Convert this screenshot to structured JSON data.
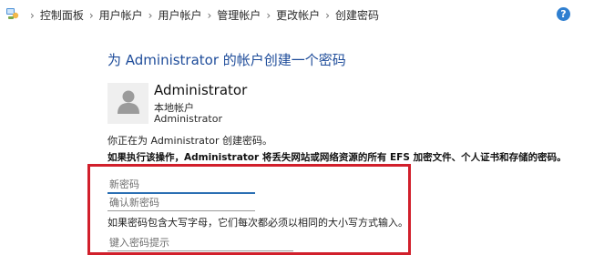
{
  "breadcrumb": {
    "items": [
      "控制面板",
      "用户帐户",
      "用户帐户",
      "管理帐户",
      "更改帐户",
      "创建密码"
    ],
    "separator": "›"
  },
  "help": {
    "label": "?"
  },
  "page": {
    "title": "为 Administrator 的帐户创建一个密码"
  },
  "account": {
    "name": "Administrator",
    "type": "本地帐户",
    "group": "Administrator"
  },
  "messages": {
    "info": "你正在为 Administrator 创建密码。",
    "warning": "如果执行该操作，Administrator 将丢失网站或网络资源的所有 EFS 加密文件、个人证书和存储的密码。",
    "case_note": "如果密码包含大写字母，它们每次都必须以相同的大小写方式输入。"
  },
  "form": {
    "new_password_placeholder": "新密码",
    "confirm_password_placeholder": "确认新密码",
    "hint_placeholder": "键入密码提示"
  },
  "colors": {
    "title": "#1e4c9a",
    "highlight_border": "#d11f2b",
    "help_icon": "#2f7fd0",
    "avatar_bg": "#efefef"
  },
  "icons": [
    "control-panel-icon",
    "help-icon",
    "user-avatar-icon"
  ]
}
